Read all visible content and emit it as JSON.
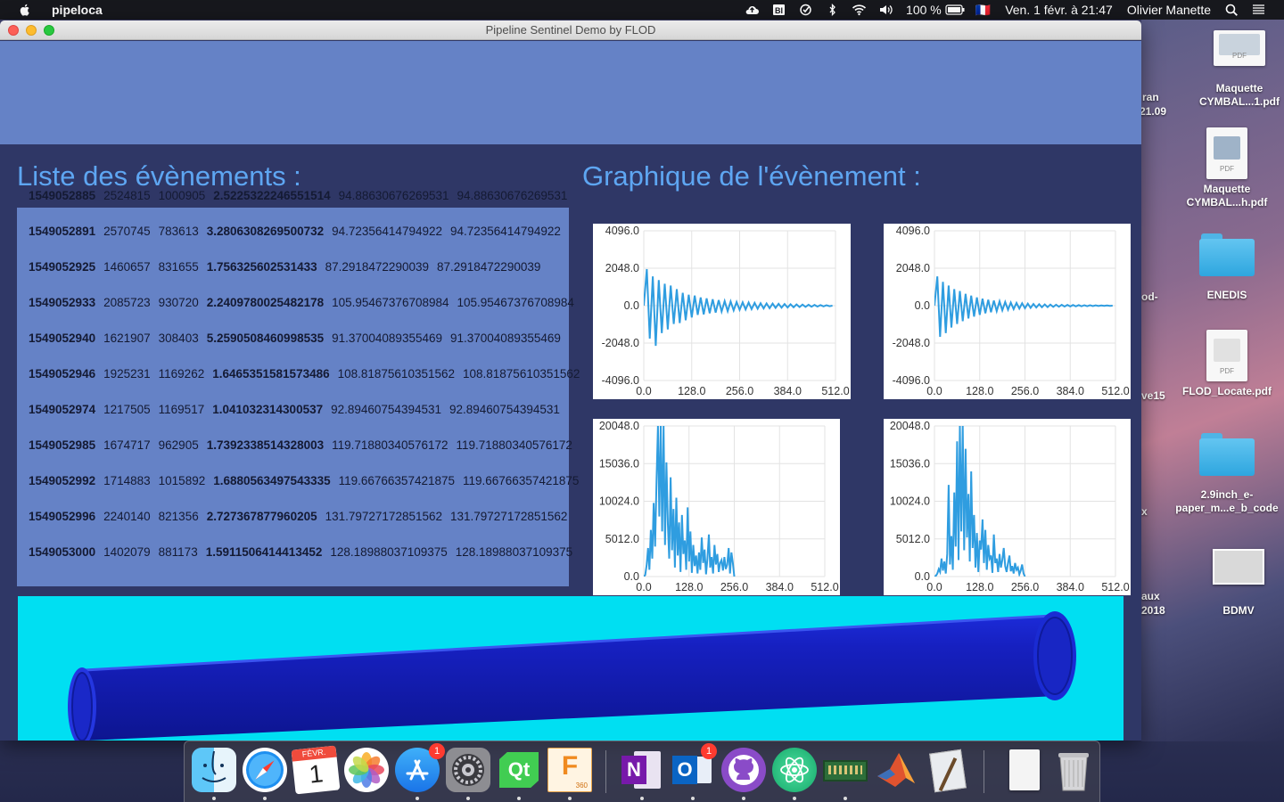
{
  "menubar": {
    "app_name": "pipeloca",
    "battery": "100 %",
    "flag": "🇫🇷",
    "datetime": "Ven. 1 févr. à  21:47",
    "user": "Olivier Manette"
  },
  "window": {
    "title": "Pipeline Sentinel Demo by FLOD"
  },
  "events_section": {
    "title": "Liste des évènements :",
    "rows": [
      [
        "1549052885",
        "2524815",
        "1000905",
        "2.5225322246551514",
        "94.88630676269531",
        "94.88630676269531"
      ],
      [
        "1549052891",
        "2570745",
        "783613",
        "3.2806308269500732",
        "94.72356414794922",
        "94.72356414794922"
      ],
      [
        "1549052925",
        "1460657",
        "831655",
        "1.756325602531433",
        "87.2918472290039",
        "87.2918472290039"
      ],
      [
        "1549052933",
        "2085723",
        "930720",
        "2.2409780025482178",
        "105.95467376708984",
        "105.95467376708984"
      ],
      [
        "1549052940",
        "1621907",
        "308403",
        "5.2590508460998535",
        "91.37004089355469",
        "91.37004089355469"
      ],
      [
        "1549052946",
        "1925231",
        "1169262",
        "1.6465351581573486",
        "108.81875610351562",
        "108.81875610351562"
      ],
      [
        "1549052974",
        "1217505",
        "1169517",
        "1.041032314300537",
        "92.89460754394531",
        "92.89460754394531"
      ],
      [
        "1549052985",
        "1674717",
        "962905",
        "1.7392338514328003",
        "119.71880340576172",
        "119.71880340576172"
      ],
      [
        "1549052992",
        "1714883",
        "1015892",
        "1.6880563497543335",
        "119.66766357421875",
        "119.66766357421875"
      ],
      [
        "1549052996",
        "2240140",
        "821356",
        "2.727367877960205",
        "131.79727172851562",
        "131.79727172851562"
      ],
      [
        "1549053000",
        "1402079",
        "881173",
        "1.5911506414413452",
        "128.18988037109375",
        "128.18988037109375"
      ]
    ]
  },
  "graph_section": {
    "title": "Graphique de l'évènement :"
  },
  "chart_data": [
    {
      "type": "line",
      "series_color": "#2f9de0",
      "xlim": [
        0,
        512
      ],
      "ylim": [
        -4096,
        4096
      ],
      "xticks": [
        "0.0",
        "128.0",
        "256.0",
        "384.0",
        "512.0"
      ],
      "yticks": [
        "4096.0",
        "2048.0",
        "0.0",
        "-2048.0",
        "-4096.0"
      ],
      "x_step": 8,
      "values": [
        0,
        2000,
        -1800,
        1600,
        -2200,
        1400,
        -1500,
        1200,
        -1300,
        1100,
        -1000,
        900,
        -950,
        700,
        -800,
        600,
        -650,
        550,
        -500,
        450,
        -480,
        400,
        -420,
        350,
        -380,
        300,
        -320,
        250,
        -300,
        230,
        -260,
        200,
        -230,
        180,
        -210,
        170,
        -190,
        150,
        -170,
        130,
        -150,
        120,
        -140,
        110,
        -120,
        100,
        -110,
        90,
        -100,
        80,
        -90,
        70,
        -80,
        60,
        -70,
        50,
        -60,
        40,
        -50,
        30,
        -40,
        20,
        -30,
        0
      ],
      "grid": true
    },
    {
      "type": "line",
      "series_color": "#2f9de0",
      "xlim": [
        0,
        512
      ],
      "ylim": [
        -4096,
        4096
      ],
      "xticks": [
        "0.0",
        "128.0",
        "256.0",
        "384.0",
        "512.0"
      ],
      "yticks": [
        "4096.0",
        "2048.0",
        "0.0",
        "-2048.0",
        "-4096.0"
      ],
      "x_step": 8,
      "values": [
        0,
        1600,
        -1700,
        1300,
        -1500,
        1100,
        -1200,
        900,
        -1000,
        800,
        -850,
        650,
        -700,
        550,
        -600,
        450,
        -500,
        380,
        -420,
        320,
        -360,
        280,
        -300,
        240,
        -260,
        200,
        -220,
        170,
        -190,
        150,
        -160,
        130,
        -140,
        110,
        -120,
        95,
        -100,
        80,
        -90,
        70,
        -80,
        60,
        -70,
        50,
        -60,
        45,
        -50,
        40,
        -45,
        35,
        -40,
        30,
        -35,
        25,
        -30,
        20,
        -25,
        15,
        -20,
        10,
        -15,
        8,
        -10,
        0
      ],
      "grid": true
    },
    {
      "type": "line",
      "series_color": "#2f9de0",
      "xlim": [
        0,
        512
      ],
      "ylim": [
        0,
        20048
      ],
      "xticks": [
        "0.0",
        "128.0",
        "256.0",
        "384.0",
        "512.0"
      ],
      "yticks": [
        "20048.0",
        "15036.0",
        "10024.0",
        "5012.0",
        "0.0"
      ],
      "x_step": 4,
      "values": [
        0,
        200,
        1500,
        3800,
        900,
        6200,
        2400,
        9800,
        4000,
        12800,
        20048,
        8000,
        20048,
        6000,
        20048,
        4200,
        15200,
        7000,
        2400,
        13200,
        3500,
        9000,
        1200,
        10500,
        2800,
        7200,
        600,
        8200,
        3000,
        4800,
        900,
        9200,
        2000,
        6000,
        500,
        4200,
        1400,
        2800,
        400,
        3200,
        900,
        5200,
        1800,
        3600,
        300,
        2400,
        5600,
        1200,
        2600,
        400,
        4200,
        1600,
        3000,
        600,
        1800,
        2200,
        800,
        2600,
        1000,
        1600,
        3800,
        400,
        3200,
        1800,
        0
      ],
      "grid": true
    },
    {
      "type": "line",
      "series_color": "#2f9de0",
      "xlim": [
        0,
        512
      ],
      "ylim": [
        0,
        20048
      ],
      "xticks": [
        "0.0",
        "128.0",
        "256.0",
        "384.0",
        "512.0"
      ],
      "yticks": [
        "20048.0",
        "15036.0",
        "10024.0",
        "5012.0",
        "0.0"
      ],
      "x_step": 4,
      "values": [
        0,
        100,
        400,
        1000,
        600,
        2400,
        800,
        2000,
        400,
        3000,
        12200,
        1600,
        5400,
        900,
        11200,
        4000,
        18000,
        2200,
        20048,
        6000,
        20048,
        3500,
        17000,
        5200,
        11000,
        2000,
        14000,
        3800,
        8200,
        1200,
        5800,
        600,
        4800,
        3600,
        7600,
        1800,
        6200,
        900,
        4200,
        2400,
        2800,
        500,
        5600,
        1800,
        2400,
        600,
        3000,
        1200,
        2200,
        3800,
        1400,
        600,
        1800,
        2800,
        700,
        1400,
        400,
        1800,
        900,
        1200,
        300,
        800,
        1600,
        400,
        0
      ],
      "grid": true
    }
  ],
  "dock": {
    "apps": [
      {
        "name": "finder-icon"
      },
      {
        "name": "safari-icon"
      },
      {
        "name": "calendar-icon",
        "month": "FÉVR.",
        "day": "1"
      },
      {
        "name": "photos-icon"
      },
      {
        "name": "app-store-icon",
        "badge": "1"
      },
      {
        "name": "system-preferences-icon"
      },
      {
        "name": "qt-creator-icon",
        "label": "Qt"
      },
      {
        "name": "fusion-360-icon",
        "label": "F",
        "sub": "360"
      },
      {
        "name": "onenote-icon",
        "label": "N"
      },
      {
        "name": "outlook-icon",
        "label": "O",
        "badge": "1"
      },
      {
        "name": "github-desktop-icon"
      },
      {
        "name": "atom-icon"
      },
      {
        "name": "fritzing-board-icon"
      },
      {
        "name": "matlab-icon"
      },
      {
        "name": "script-editor-icon"
      },
      {
        "name": "documents-stack-icon"
      },
      {
        "name": "trash-icon"
      }
    ]
  },
  "desktop": {
    "items": [
      {
        "label": "Maquette CYMBAL...1.pdf",
        "pdf_tag": "PDF"
      },
      {
        "label": "Maquette CYMBAL...h.pdf",
        "pdf_tag": "PDF"
      },
      {
        "label": "ENEDIS"
      },
      {
        "label": "FLOD_Locate.pdf",
        "pdf_tag": "PDF"
      },
      {
        "label": "2.9inch_e-paper_m...e_b_code"
      },
      {
        "label": "BDMV"
      }
    ],
    "partial_labels": [
      "ran",
      "21.09",
      "od-",
      "ve15",
      "aux",
      "2018",
      "x"
    ]
  }
}
